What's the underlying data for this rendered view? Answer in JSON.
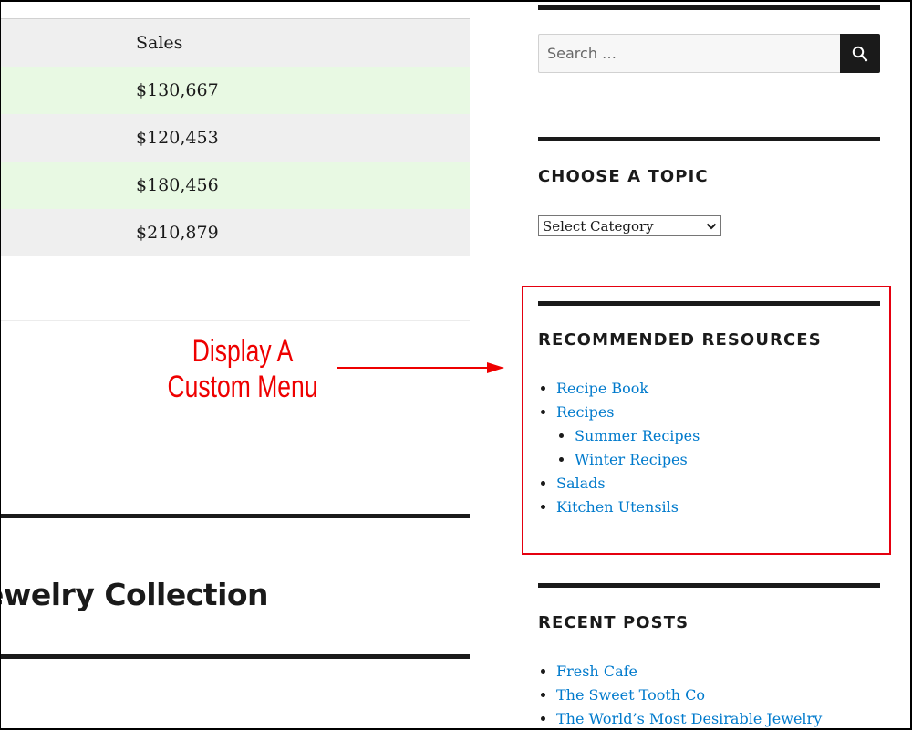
{
  "main": {
    "table": {
      "header": "Sales",
      "rows": [
        "$130,667",
        "$120,453",
        "$180,456",
        "$210,879"
      ]
    },
    "annotation": {
      "line1": "Display A",
      "line2": "Custom Menu",
      "color": "#ee0000"
    },
    "post_title": "ewelry Collection"
  },
  "sidebar": {
    "search": {
      "placeholder": "Search …",
      "value": "",
      "button_icon": "search-icon"
    },
    "choose_topic": {
      "title": "CHOOSE A TOPIC",
      "select_value": "Select Category"
    },
    "recommended_resources": {
      "title": "RECOMMENDED RESOURCES",
      "items": [
        {
          "label": "Recipe Book"
        },
        {
          "label": "Recipes",
          "children": [
            {
              "label": "Summer Recipes"
            },
            {
              "label": "Winter Recipes"
            }
          ]
        },
        {
          "label": "Salads"
        },
        {
          "label": "Kitchen Utensils"
        }
      ]
    },
    "recent_posts": {
      "title": "RECENT POSTS",
      "items": [
        {
          "label": "Fresh Cafe"
        },
        {
          "label": "The Sweet Tooth Co"
        },
        {
          "label": "The World’s Most Desirable Jewelry"
        }
      ]
    }
  },
  "colors": {
    "link": "#007acc",
    "text": "#1a1a1a",
    "highlight_border": "#e5000f",
    "row_green": "#e8f9e3",
    "row_grey": "#efefef"
  }
}
